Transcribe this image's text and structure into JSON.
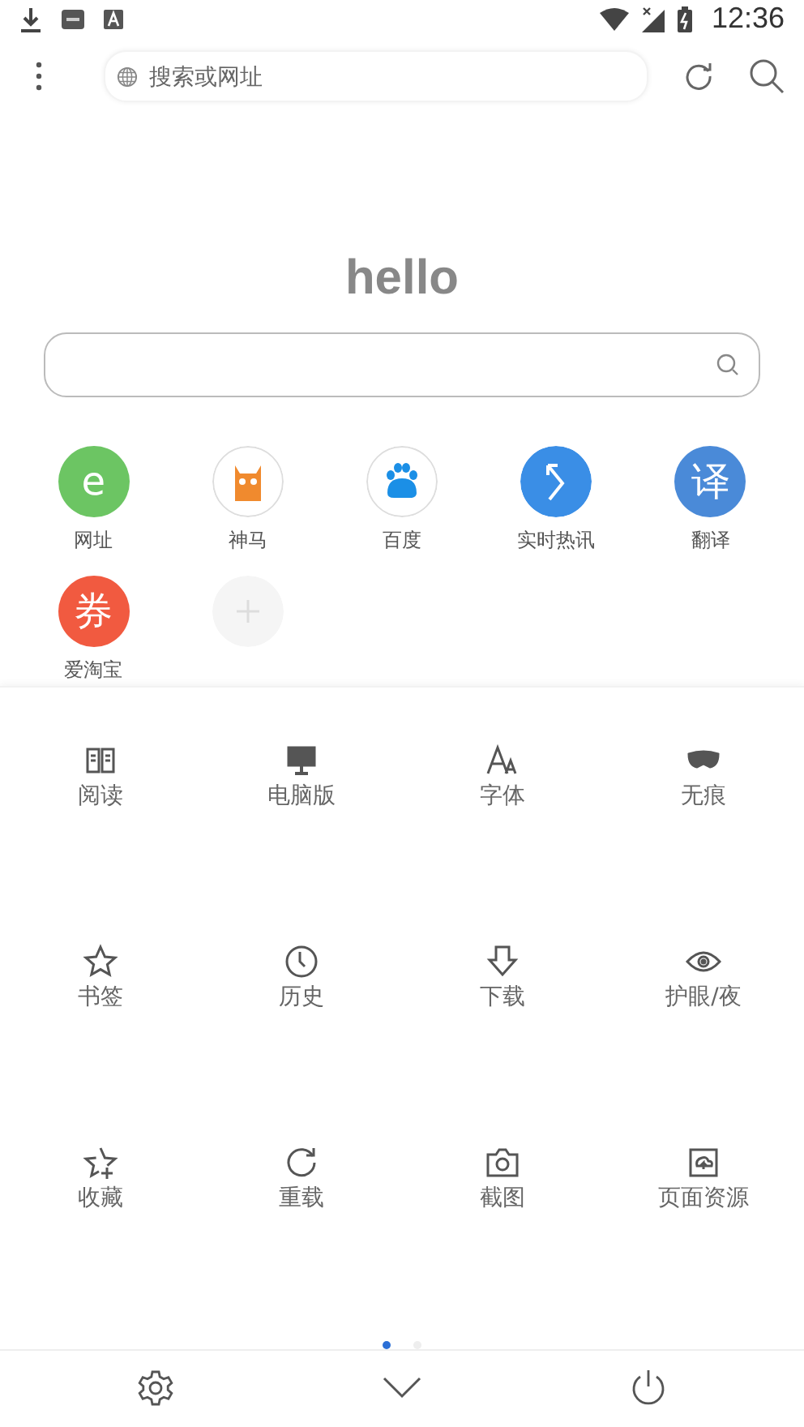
{
  "status_bar": {
    "time": "12:36"
  },
  "address_bar": {
    "placeholder": "搜索或网址"
  },
  "logo": "hello",
  "shortcuts": [
    {
      "label": "网址",
      "kind": "glyph",
      "glyph": "e",
      "color": "#6cc563"
    },
    {
      "label": "神马",
      "kind": "llama",
      "color": "#f08a2e"
    },
    {
      "label": "百度",
      "kind": "paw",
      "color": "#1b8fe6"
    },
    {
      "label": "实时热讯",
      "kind": "arrow",
      "color": "#3a8ee6"
    },
    {
      "label": "翻译",
      "kind": "glyph",
      "glyph": "译",
      "color": "#4a8ad8"
    },
    {
      "label": "爱淘宝",
      "kind": "glyph",
      "glyph": "券",
      "color": "#f15a40"
    }
  ],
  "menu_items": [
    {
      "label": "阅读",
      "kind": "book"
    },
    {
      "label": "电脑版",
      "kind": "monitor"
    },
    {
      "label": "字体",
      "kind": "font"
    },
    {
      "label": "无痕",
      "kind": "mask"
    },
    {
      "label": "书签",
      "kind": "star"
    },
    {
      "label": "历史",
      "kind": "clock"
    },
    {
      "label": "下载",
      "kind": "download"
    },
    {
      "label": "护眼/夜",
      "kind": "eye"
    },
    {
      "label": "收藏",
      "kind": "starplus"
    },
    {
      "label": "重载",
      "kind": "reload"
    },
    {
      "label": "截图",
      "kind": "camera"
    },
    {
      "label": "页面资源",
      "kind": "resource"
    }
  ],
  "pages": [
    {
      "selected": true
    },
    {
      "selected": false
    }
  ]
}
